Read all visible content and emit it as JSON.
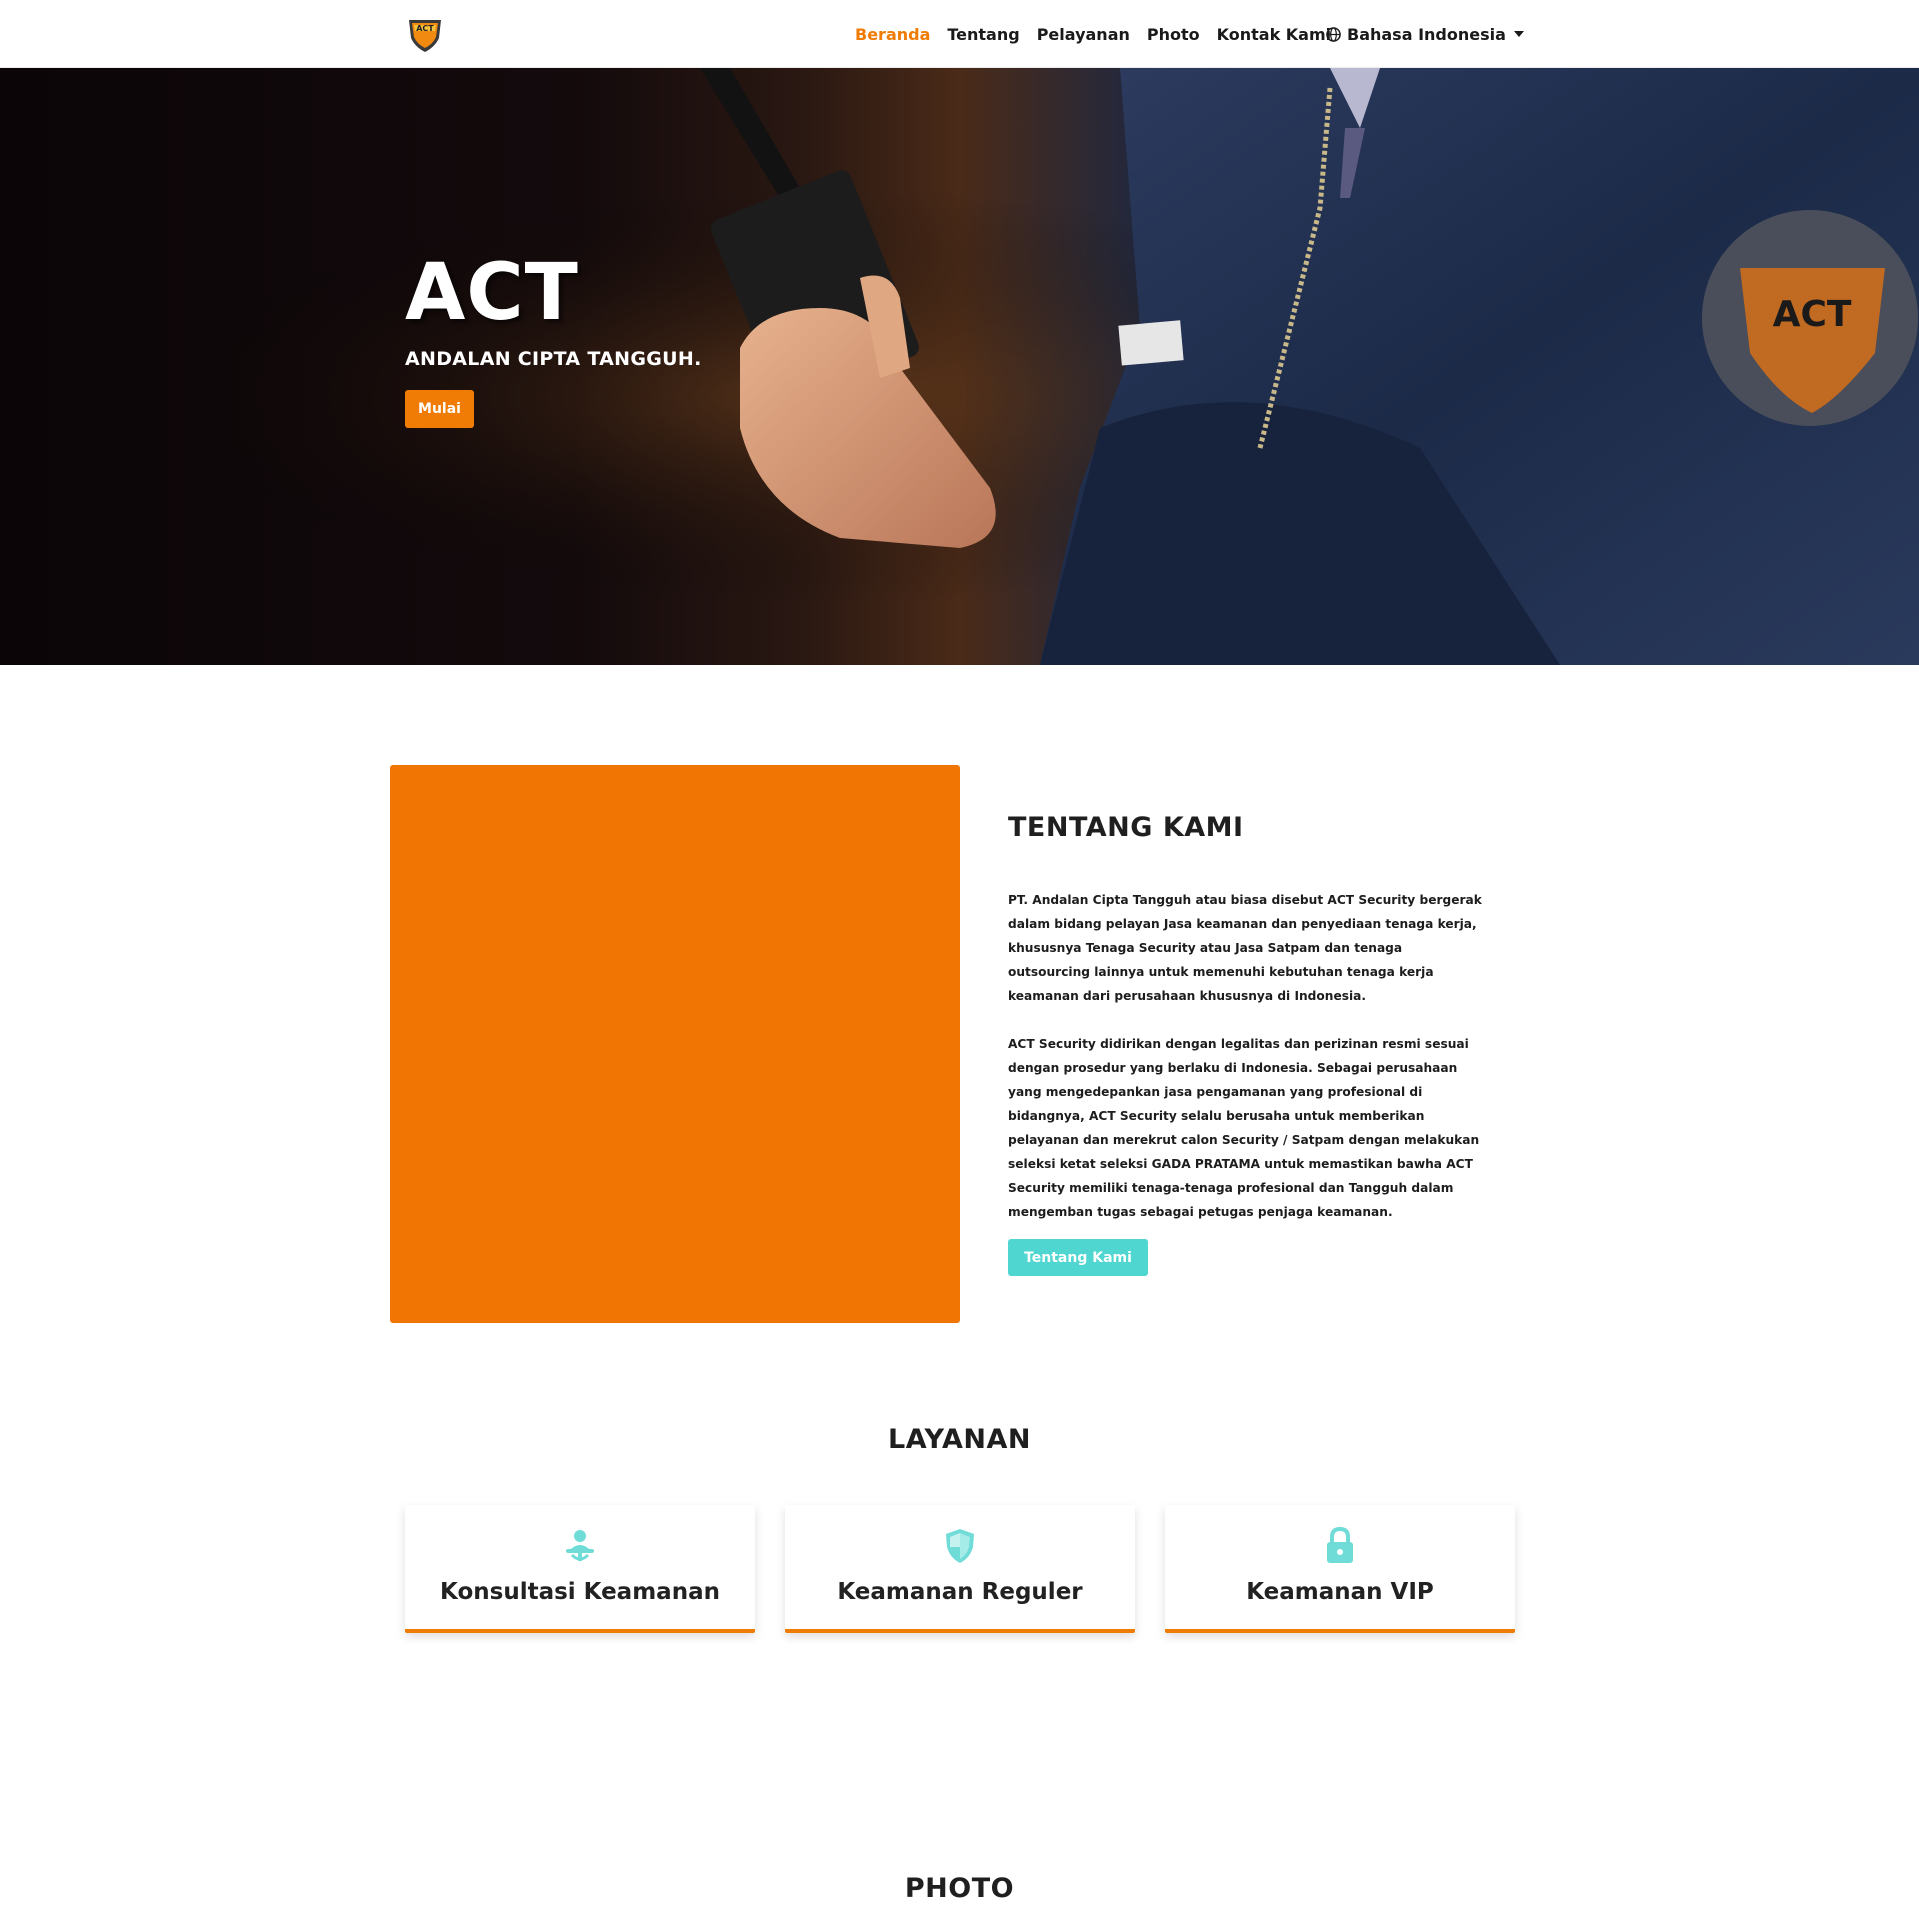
{
  "nav": {
    "items": [
      {
        "label": "Beranda",
        "active": true
      },
      {
        "label": "Tentang",
        "active": false
      },
      {
        "label": "Pelayanan",
        "active": false
      },
      {
        "label": "Photo",
        "active": false
      },
      {
        "label": "Kontak Kami",
        "active": false
      }
    ],
    "language": "Bahasa Indonesia",
    "logo_text": "ACT"
  },
  "hero": {
    "title": "ACT",
    "subtitle": "ANDALAN CIPTA TANGGUH.",
    "button": "Mulai"
  },
  "about": {
    "title": "TENTANG KAMI",
    "paragraphs": [
      "PT. Andalan Cipta Tangguh atau biasa disebut ACT Security bergerak dalam bidang pelayan Jasa keamanan dan penyediaan tenaga kerja, khususnya Tenaga Security atau Jasa Satpam dan tenaga outsourcing lainnya untuk memenuhi kebutuhan tenaga kerja keamanan dari perusahaan khususnya di Indonesia.",
      "ACT Security didirikan dengan legalitas dan perizinan resmi sesuai dengan prosedur yang berlaku di Indonesia. Sebagai perusahaan yang mengedepankan jasa pengamanan yang profesional di bidangnya, ACT Security selalu berusaha untuk memberikan pelayanan dan  merekrut calon Security / Satpam dengan melakukan seleksi  ketat seleksi GADA PRATAMA untuk memastikan bawha ACT Security memiliki tenaga-tenaga profesional dan Tangguh dalam mengemban tugas sebagai petugas penjaga keamanan."
    ],
    "button": "Tentang Kami"
  },
  "services": {
    "title": "LAYANAN",
    "items": [
      {
        "label": "Konsultasi Keamanan",
        "icon": "person-desk-icon"
      },
      {
        "label": "Keamanan Reguler",
        "icon": "shield-icon"
      },
      {
        "label": "Keamanan VIP",
        "icon": "lock-icon"
      }
    ]
  },
  "photo": {
    "title": "PHOTO"
  },
  "colors": {
    "accent": "#f07b05",
    "teal": "#4fd6d0"
  }
}
